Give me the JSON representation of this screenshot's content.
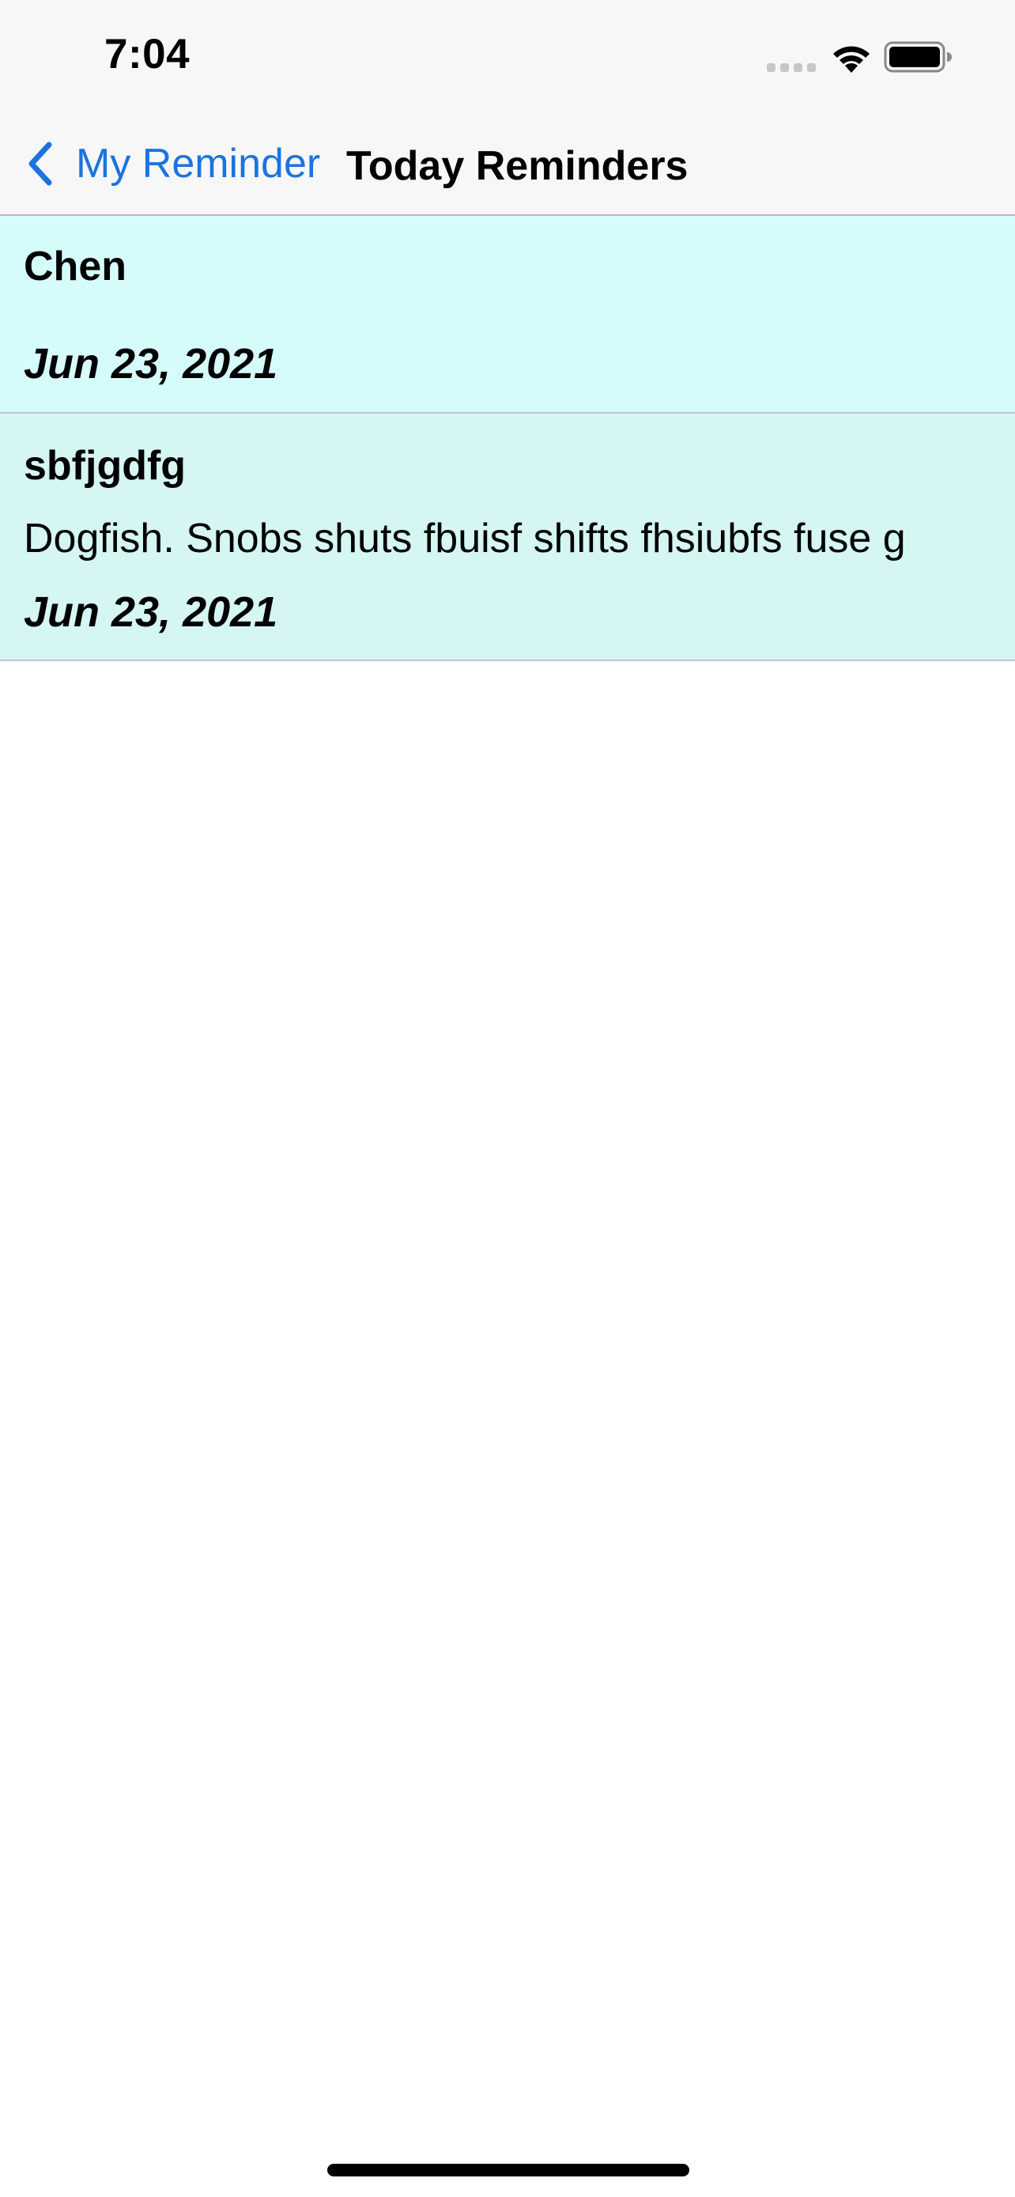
{
  "colors": {
    "accent": "#1a74e0",
    "row_backgrounds": [
      "#d6fbfb",
      "#d5f6f3"
    ]
  },
  "status_bar": {
    "time": "7:04",
    "icons": [
      "signal-dots-icon",
      "wifi-icon",
      "battery-icon"
    ]
  },
  "nav": {
    "back_label": "My Reminder",
    "title": "Today Reminders"
  },
  "reminders": [
    {
      "title": "Chen",
      "body": "",
      "date": "Jun 23, 2021"
    },
    {
      "title": "sbfjgdfg",
      "body": "Dogfish. Snobs shuts fbuisf shifts fhsiubfs fuse g",
      "date": "Jun 23, 2021"
    }
  ]
}
